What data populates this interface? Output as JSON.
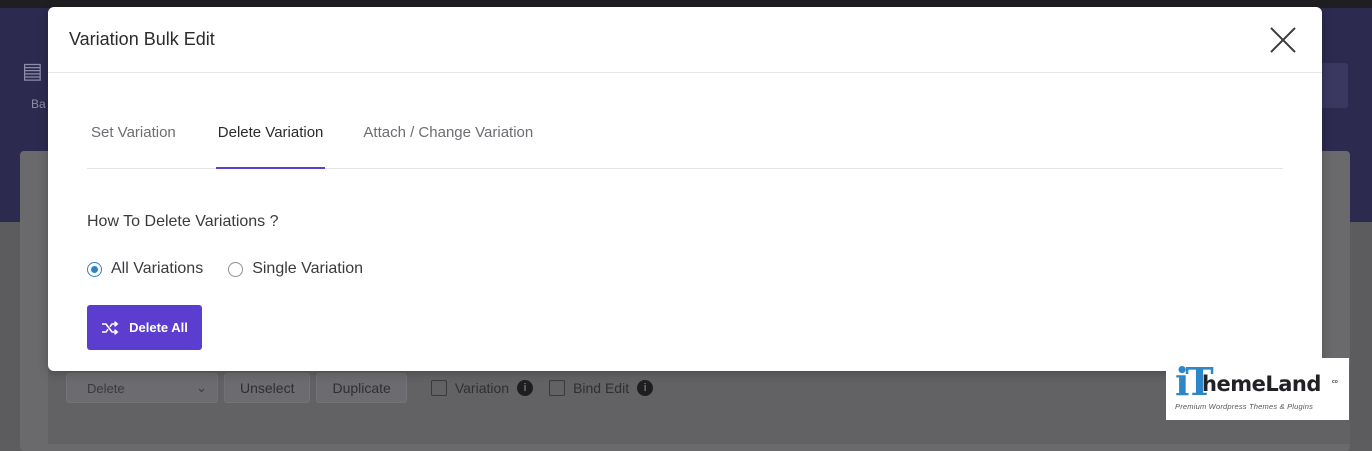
{
  "background": {
    "sidebar_label": "Ba",
    "toolbar": {
      "select_value": "Delete",
      "unselect_label": "Unselect",
      "duplicate_label": "Duplicate",
      "variation_label": "Variation",
      "bind_edit_label": "Bind Edit"
    }
  },
  "modal": {
    "title": "Variation Bulk Edit",
    "tabs": [
      {
        "label": "Set Variation",
        "active": false
      },
      {
        "label": "Delete Variation",
        "active": true
      },
      {
        "label": "Attach / Change Variation",
        "active": false
      }
    ],
    "question": "How To Delete Variations ?",
    "options": [
      {
        "label": "All Variations",
        "checked": true
      },
      {
        "label": "Single Variation",
        "checked": false
      }
    ],
    "delete_button": {
      "label": "Delete All",
      "icon": "shuffle-icon"
    }
  },
  "logo": {
    "brand_prefix": "iT",
    "brand_name": "hemeLand",
    "mark": "co",
    "tagline": "Premium Wordpress Themes & Plugins"
  },
  "colors": {
    "accent": "#5b3ecf",
    "radio_checked": "#2c84c5",
    "overlay_band": "#2c2a4f"
  }
}
